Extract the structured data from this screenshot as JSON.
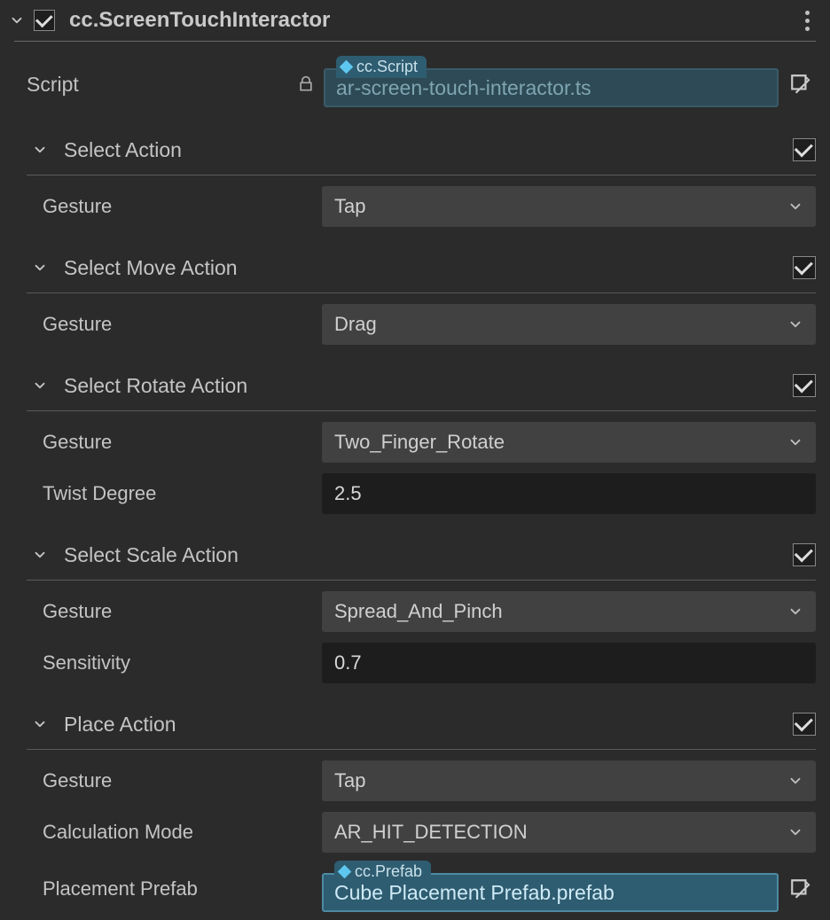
{
  "component": {
    "enabled": true,
    "title": "cc.ScreenTouchInteractor"
  },
  "script": {
    "label": "Script",
    "tag": "cc.Script",
    "value": "ar-screen-touch-interactor.ts"
  },
  "sections": {
    "select_action": {
      "title": "Select Action",
      "enabled": true,
      "gesture_label": "Gesture",
      "gesture_value": "Tap"
    },
    "select_move_action": {
      "title": "Select Move Action",
      "enabled": true,
      "gesture_label": "Gesture",
      "gesture_value": "Drag"
    },
    "select_rotate_action": {
      "title": "Select Rotate Action",
      "enabled": true,
      "gesture_label": "Gesture",
      "gesture_value": "Two_Finger_Rotate",
      "twist_label": "Twist Degree",
      "twist_value": "2.5"
    },
    "select_scale_action": {
      "title": "Select Scale Action",
      "enabled": true,
      "gesture_label": "Gesture",
      "gesture_value": "Spread_And_Pinch",
      "sensitivity_label": "Sensitivity",
      "sensitivity_value": "0.7"
    },
    "place_action": {
      "title": "Place Action",
      "enabled": true,
      "gesture_label": "Gesture",
      "gesture_value": "Tap",
      "calc_label": "Calculation Mode",
      "calc_value": "AR_HIT_DETECTION",
      "prefab_label": "Placement Prefab",
      "prefab_tag": "cc.Prefab",
      "prefab_value": "Cube Placement Prefab.prefab"
    }
  }
}
